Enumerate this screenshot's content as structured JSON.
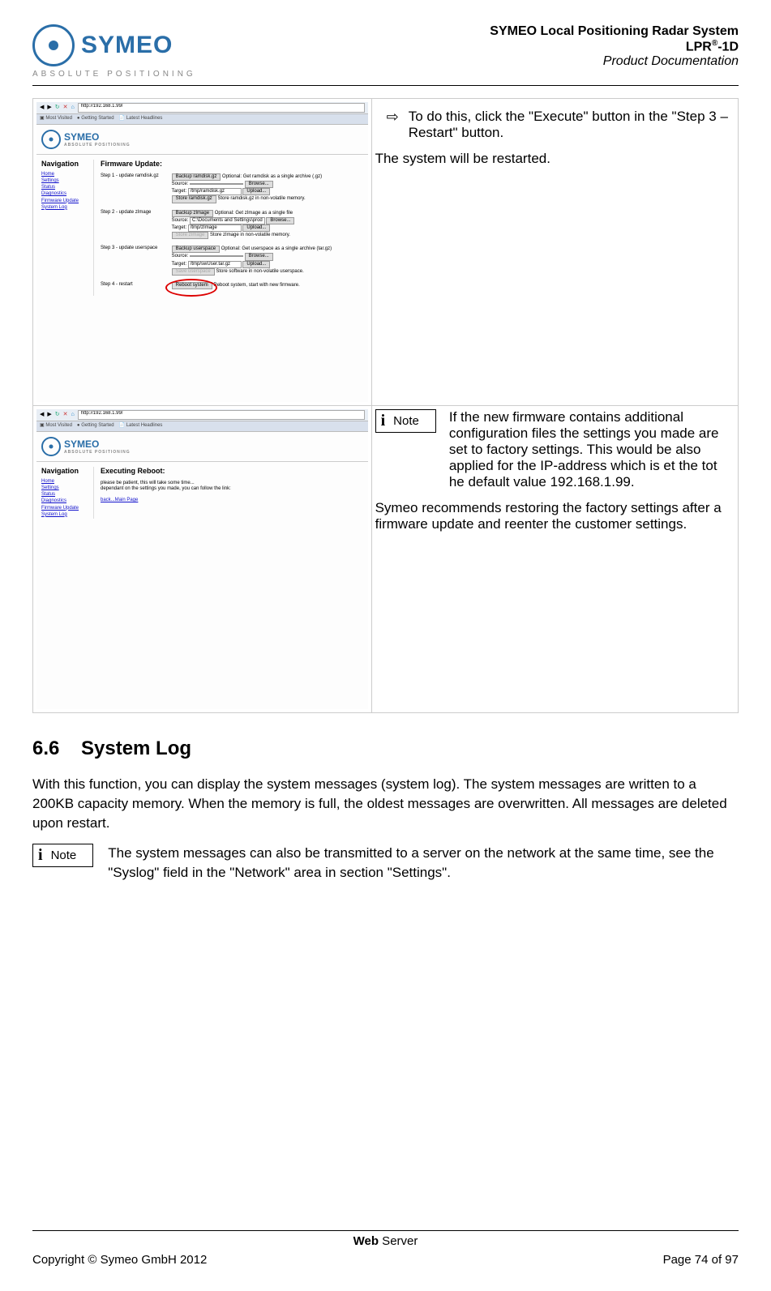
{
  "header": {
    "logo_text": "SYMEO",
    "logo_tagline": "ABSOLUTE POSITIONING",
    "title_line1": "SYMEO Local Positioning Radar System",
    "title_line2_prefix": "LPR",
    "title_line2_sup": "®",
    "title_line2_suffix": "-1D",
    "title_line3": "Product Documentation"
  },
  "row1": {
    "instruction": "To do this, click the \"Execute\" button in the \"Step 3 – Restart\" button.",
    "result": "The system will be restarted."
  },
  "row2": {
    "note_label": "Note",
    "note_text": "If the new firmware contains additional configuration files the settings you made are set to factory settings. This would be also applied for the IP-address which is et the tot he default value 192.168.1.99.",
    "recommend": "Symeo recommends restoring the factory settings after a firmware update and reenter the customer settings."
  },
  "section": {
    "number": "6.6",
    "title": "System Log",
    "para": "With this function, you can display the system messages (system log). The system messages are written to a 200KB capacity memory. When the memory is full, the oldest messages are overwritten. All messages are deleted upon restart.",
    "note_label": "Note",
    "note_text": "The system messages can also be transmitted to a server on the network at the same time, see the \"Syslog\" field in the \"Network\" area in section \"Settings\"."
  },
  "mini1": {
    "url": "http://192.168.1.99/",
    "bookmarks": [
      "Most Visited",
      "Getting Started",
      "Latest Headlines"
    ],
    "nav_title": "Navigation",
    "nav_links": [
      "Home",
      "Settings",
      "Status",
      "Diagnostics",
      "Firmware Update",
      "System Log"
    ],
    "main_title": "Firmware Update:",
    "step1": {
      "label": "Step 1 - update ramdisk.gz",
      "backup_btn": "Backup ramdisk.gz",
      "backup_hint": "Optional: Get ramdisk as a single archive (.gz)",
      "source_label": "Source:",
      "browse_btn": "Browse...",
      "target_label": "Target:",
      "target_val": "/tmp/ramdisk.gz",
      "upload_btn": "Upload...",
      "store_btn": "Store ramdisk.gz",
      "store_hint": "Store ramdisk.gz in non-volatile memory."
    },
    "step2": {
      "label": "Step 2 - update zImage",
      "backup_btn": "Backup zImage",
      "backup_hint": "Optional: Get zImage as a single file",
      "source_label": "Source:",
      "source_val": "C:\\Documents and Settings\\prod",
      "browse_btn": "Browse...",
      "target_label": "Target:",
      "target_val": "/tmp/zImage",
      "upload_btn": "Upload...",
      "store_btn": "Store zImage",
      "store_hint": "Store zImage in non-volatile memory."
    },
    "step3": {
      "label": "Step 3 - update userspace",
      "backup_btn": "Backup userspace",
      "backup_hint": "Optional: Get userspace as a single archive (tar.gz)",
      "source_label": "Source:",
      "browse_btn": "Browse...",
      "target_label": "Target:",
      "target_val": "/tmp/swUser.tar.gz",
      "upload_btn": "Upload...",
      "store_btn": "Save userspace",
      "store_hint": "Store software in non-volatile userspace."
    },
    "step4": {
      "label": "Step 4 - restart",
      "reboot_btn": "Reboot system",
      "reboot_hint": "Reboot system, start with new firmware."
    }
  },
  "mini2": {
    "url": "http://192.168.1.99/",
    "bookmarks": [
      "Most Visited",
      "Getting Started",
      "Latest Headlines"
    ],
    "nav_title": "Navigation",
    "nav_links": [
      "Home",
      "Settings",
      "Status",
      "Diagnostics",
      "Firmware Update",
      "System Log"
    ],
    "main_title": "Executing Reboot:",
    "line1": "please be patient, this will take some time...",
    "line2": "dependant on the settings you made, you can follow the link:",
    "back_link": "back...Main Page"
  },
  "footer": {
    "center_bold": "Web",
    "center_rest": " Server",
    "copyright": "Copyright © Symeo GmbH 2012",
    "page": "Page 74 of 97"
  }
}
